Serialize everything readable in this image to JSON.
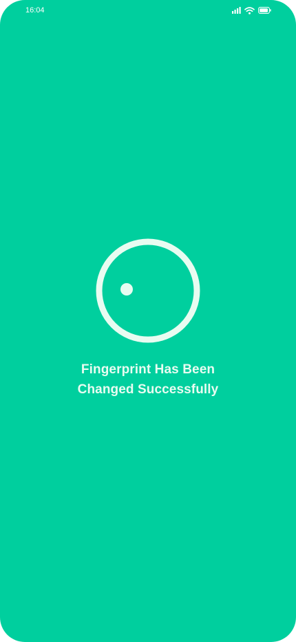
{
  "status_bar": {
    "time": "16:04",
    "icons": [
      "signal-icon",
      "wifi-icon",
      "battery-icon"
    ]
  },
  "main": {
    "indicator_icon": "loading-spinner-icon",
    "message_line1": "Fingerprint Has Been",
    "message_line2": "Changed Successfully"
  },
  "colors": {
    "background": "#00CF9E",
    "accent_light": "#E8FCF1",
    "status_text": "#FFFFFF"
  }
}
